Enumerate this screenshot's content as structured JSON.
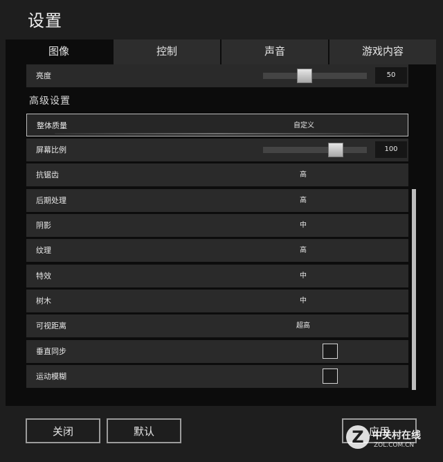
{
  "window": {
    "title": "设置"
  },
  "tabs": [
    {
      "label": "图像",
      "active": true
    },
    {
      "label": "控制",
      "active": false
    },
    {
      "label": "声音",
      "active": false
    },
    {
      "label": "游戏内容",
      "active": false
    }
  ],
  "brightness": {
    "label": "亮度",
    "value": "50",
    "level": 50
  },
  "advanced": {
    "title": "高级设置",
    "overall_quality": {
      "label": "整体质量",
      "value": "自定义"
    },
    "screen_ratio": {
      "label": "屏幕比例",
      "value": "100",
      "level": 100
    },
    "settings": [
      {
        "label": "抗锯齿",
        "value": "高"
      },
      {
        "label": "后期处理",
        "value": "高"
      },
      {
        "label": "阴影",
        "value": "中"
      },
      {
        "label": "纹理",
        "value": "高"
      },
      {
        "label": "特效",
        "value": "中"
      },
      {
        "label": "树木",
        "value": "中"
      },
      {
        "label": "可视距离",
        "value": "超高"
      }
    ],
    "vsync": {
      "label": "垂直同步",
      "checked": false
    },
    "motion_blur": {
      "label": "运动模糊",
      "checked": false
    }
  },
  "footer": {
    "close_label": "关闭",
    "default_label": "默认",
    "apply_label": "应用"
  },
  "watermark": {
    "cn": "中关村在线",
    "en": "ZOL.COM.CN",
    "logo": "Z"
  },
  "colors": {
    "panel": "#0c0c0c",
    "row": "#2a2a2a",
    "tab": "#2d2d2d",
    "background": "#1e1e1e"
  }
}
